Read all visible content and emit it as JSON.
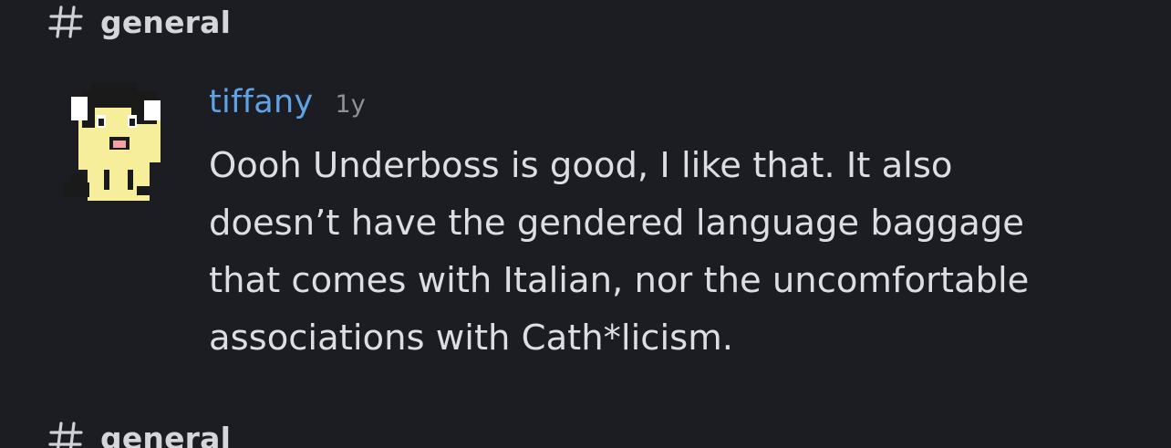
{
  "channel_top": {
    "icon": "hash-icon",
    "name": "general"
  },
  "message": {
    "username": "tiffany",
    "timestamp": "1y",
    "username_color": "#5fa3e6",
    "lines": [
      "Oooh Underboss is good, I like that. It also",
      "doesn’t have the gendered language baggage",
      "that comes with Italian, nor the uncomfortable",
      "associations with Cath*licism."
    ]
  },
  "channel_bottom": {
    "icon": "hash-icon",
    "name": "general"
  },
  "colors": {
    "background": "#1c1d22",
    "text": "#dcdee2",
    "muted": "#8e9198"
  }
}
